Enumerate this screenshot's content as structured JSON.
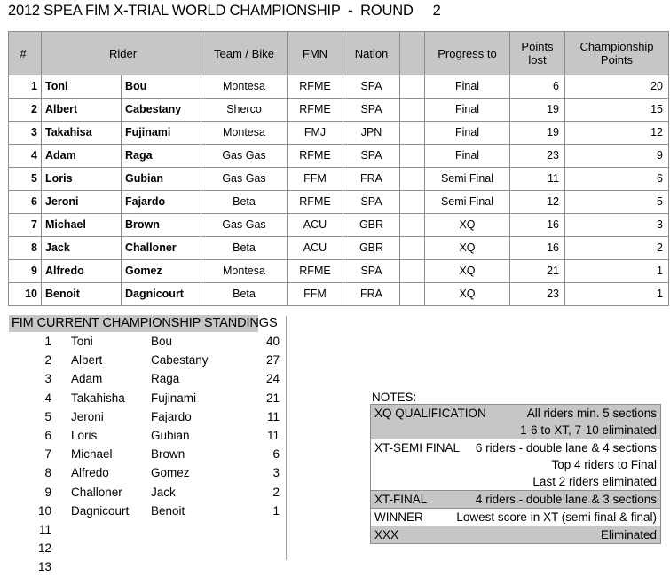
{
  "title": "2012 SPEA FIM X-TRIAL WORLD CHAMPIONSHIP  -  ROUND     2",
  "colors": {
    "header_fill": "#c6c6c6",
    "border": "#8c8c8c",
    "background": "#ffffff",
    "text": "#000000"
  },
  "results": {
    "columns": {
      "number": "#",
      "rider": "Rider",
      "team_bike": "Team / Bike",
      "fmn": "FMN",
      "nation": "Nation",
      "spacer": "",
      "progress_to": "Progress to",
      "points_lost": "Points lost",
      "points_lost_line1": "Points",
      "points_lost_line2": "lost",
      "championship_points": "Championship Points",
      "championship_points_line1": "Championship",
      "championship_points_line2": "Points"
    },
    "rows": [
      {
        "pos": "1",
        "first": "Toni",
        "last": "Bou",
        "team": "Montesa",
        "fmn": "RFME",
        "nation": "SPA",
        "progress": "Final",
        "lost": "6",
        "champ": "20"
      },
      {
        "pos": "2",
        "first": "Albert",
        "last": "Cabestany",
        "team": "Sherco",
        "fmn": "RFME",
        "nation": "SPA",
        "progress": "Final",
        "lost": "19",
        "champ": "15"
      },
      {
        "pos": "3",
        "first": "Takahisa",
        "last": "Fujinami",
        "team": "Montesa",
        "fmn": "FMJ",
        "nation": "JPN",
        "progress": "Final",
        "lost": "19",
        "champ": "12"
      },
      {
        "pos": "4",
        "first": "Adam",
        "last": "Raga",
        "team": "Gas Gas",
        "fmn": "RFME",
        "nation": "SPA",
        "progress": "Final",
        "lost": "23",
        "champ": "9"
      },
      {
        "pos": "5",
        "first": "Loris",
        "last": "Gubian",
        "team": "Gas Gas",
        "fmn": "FFM",
        "nation": "FRA",
        "progress": "Semi Final",
        "lost": "11",
        "champ": "6"
      },
      {
        "pos": "6",
        "first": "Jeroni",
        "last": "Fajardo",
        "team": "Beta",
        "fmn": "RFME",
        "nation": "SPA",
        "progress": "Semi Final",
        "lost": "12",
        "champ": "5"
      },
      {
        "pos": "7",
        "first": "Michael",
        "last": "Brown",
        "team": "Gas Gas",
        "fmn": "ACU",
        "nation": "GBR",
        "progress": "XQ",
        "lost": "16",
        "champ": "3"
      },
      {
        "pos": "8",
        "first": "Jack",
        "last": "Challoner",
        "team": "Beta",
        "fmn": "ACU",
        "nation": "GBR",
        "progress": "XQ",
        "lost": "16",
        "champ": "2"
      },
      {
        "pos": "9",
        "first": "Alfredo",
        "last": "Gomez",
        "team": "Montesa",
        "fmn": "RFME",
        "nation": "SPA",
        "progress": "XQ",
        "lost": "21",
        "champ": "1"
      },
      {
        "pos": "10",
        "first": "Benoit",
        "last": "Dagnicourt",
        "team": "Beta",
        "fmn": "FFM",
        "nation": "FRA",
        "progress": "XQ",
        "lost": "23",
        "champ": "1"
      }
    ]
  },
  "standings": {
    "header": "FIM CURRENT CHAMPIONSHIP STANDINGS",
    "rows": [
      {
        "pos": "1",
        "first": "Toni",
        "last": "Bou",
        "points": "40"
      },
      {
        "pos": "2",
        "first": "Albert",
        "last": "Cabestany",
        "points": "27"
      },
      {
        "pos": "3",
        "first": "Adam",
        "last": "Raga",
        "points": "24"
      },
      {
        "pos": "4",
        "first": "Takahisha",
        "last": "Fujinami",
        "points": "21"
      },
      {
        "pos": "5",
        "first": "Jeroni",
        "last": "Fajardo",
        "points": "11"
      },
      {
        "pos": "6",
        "first": "Loris",
        "last": "Gubian",
        "points": "11"
      },
      {
        "pos": "7",
        "first": "Michael",
        "last": "Brown",
        "points": "6"
      },
      {
        "pos": "8",
        "first": "Alfredo",
        "last": "Gomez",
        "points": "3"
      },
      {
        "pos": "9",
        "first": "Challoner",
        "last": "Jack",
        "points": "2"
      },
      {
        "pos": "10",
        "first": "Dagnicourt",
        "last": "Benoit",
        "points": "1"
      },
      {
        "pos": "11",
        "first": "",
        "last": "",
        "points": ""
      },
      {
        "pos": "12",
        "first": "",
        "last": "",
        "points": ""
      },
      {
        "pos": "13",
        "first": "",
        "last": "",
        "points": ""
      }
    ]
  },
  "notes": {
    "label": "NOTES:",
    "rows": [
      {
        "label": "XQ  QUALIFICATION",
        "text": "All riders     min. 5 sections",
        "shaded": true
      },
      {
        "label": "",
        "text": "1-6 to XT, 7-10 eliminated",
        "shaded": true
      },
      {
        "label": "XT-SEMI FINAL",
        "text": "6 riders - double lane & 4 sections",
        "shaded": false
      },
      {
        "label": "",
        "text": "Top 4 riders to Final",
        "shaded": false
      },
      {
        "label": "",
        "text": "Last 2 riders eliminated",
        "shaded": false
      },
      {
        "label": "XT-FINAL",
        "text": "4 riders - double lane & 3 sections",
        "shaded": true
      },
      {
        "label": "WINNER",
        "text": "Lowest score in XT (semi final & final)",
        "shaded": false
      },
      {
        "label": "XXX",
        "text": "Eliminated",
        "shaded": true
      }
    ]
  }
}
